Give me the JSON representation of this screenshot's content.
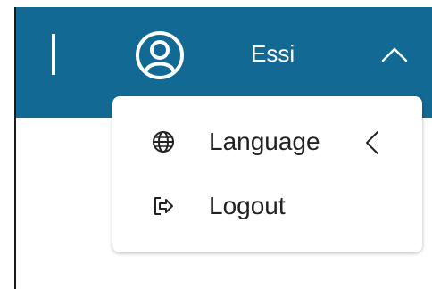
{
  "header": {
    "user_name": "Essi",
    "colors": {
      "bar": "#126a94",
      "text": "#ffffff"
    },
    "icons": {
      "avatar": "user-circle-icon",
      "toggle": "chevron-up-icon"
    }
  },
  "user_menu": {
    "items": [
      {
        "label": "Language",
        "icon": "globe-icon",
        "submenu_icon": "chevron-left-icon"
      },
      {
        "label": "Logout",
        "icon": "logout-icon"
      }
    ]
  }
}
